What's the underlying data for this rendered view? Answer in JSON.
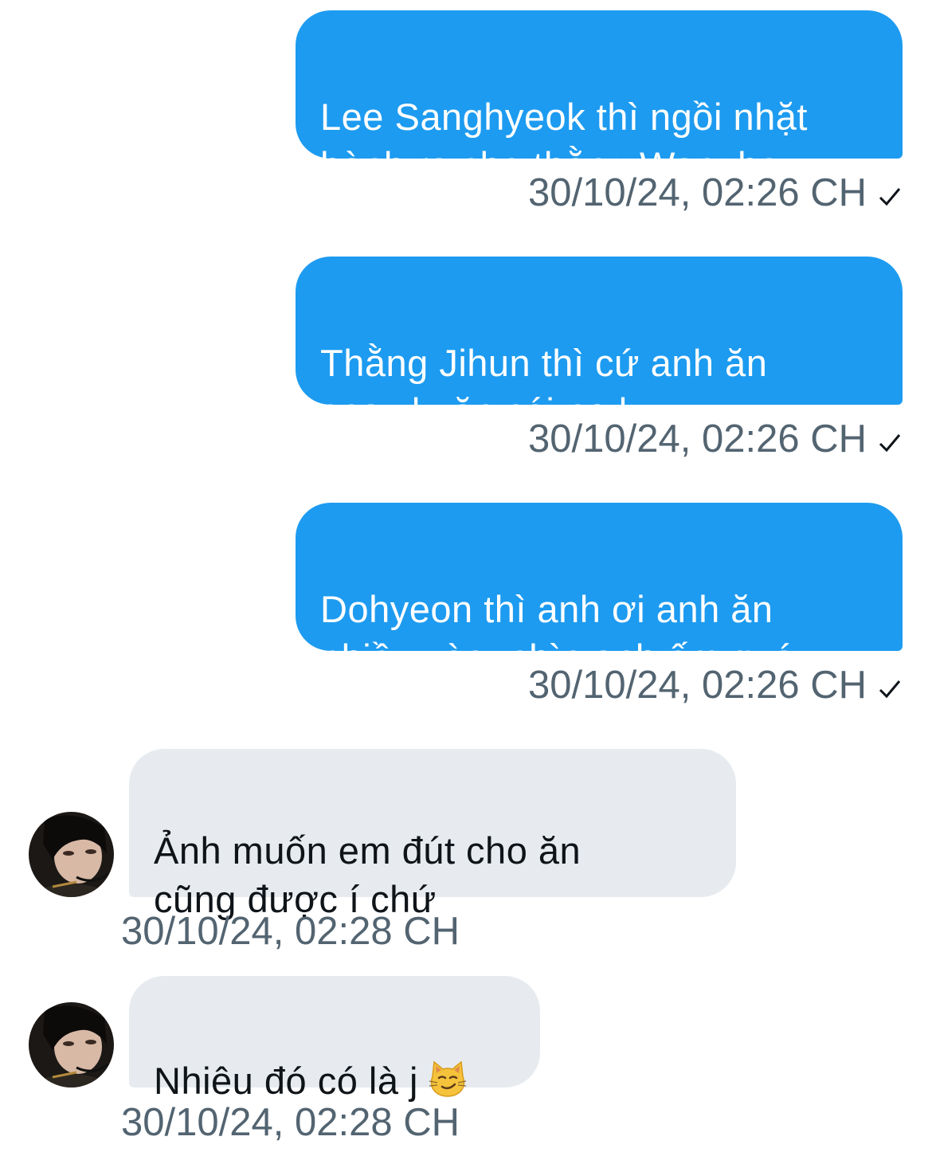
{
  "messages": [
    {
      "direction": "outgoing",
      "text": "Lee Sanghyeok thì ngồi nhặt\nhành ra cho thằng Wangho",
      "timestamp": "30/10/24, 02:26 CH",
      "status": "sent"
    },
    {
      "direction": "outgoing",
      "text": "Thằng Jihun thì cứ anh ăn\ncnay k, ăn cái nọ k",
      "timestamp": "30/10/24, 02:26 CH",
      "status": "sent"
    },
    {
      "direction": "outgoing",
      "text": "Dohyeon thì anh ơi anh ăn\nnhiều vào, nhìn anh ốm quá",
      "timestamp": "30/10/24, 02:26 CH",
      "status": "sent"
    },
    {
      "direction": "incoming",
      "text": "Ảnh muốn em đút cho ăn\ncũng được í chứ",
      "timestamp": "30/10/24, 02:28 CH",
      "avatar_icon": "user-avatar"
    },
    {
      "direction": "incoming",
      "text": "Nhiêu đó có là j",
      "emoji": "smirking-cat-emoji",
      "timestamp": "30/10/24, 02:28 CH",
      "avatar_icon": "user-avatar"
    }
  ],
  "colors": {
    "outgoing_bubble": "#1d9bf0",
    "incoming_bubble": "#e7ebef",
    "timestamp": "#536471",
    "outgoing_text": "#ffffff",
    "incoming_text": "#0f1419"
  }
}
